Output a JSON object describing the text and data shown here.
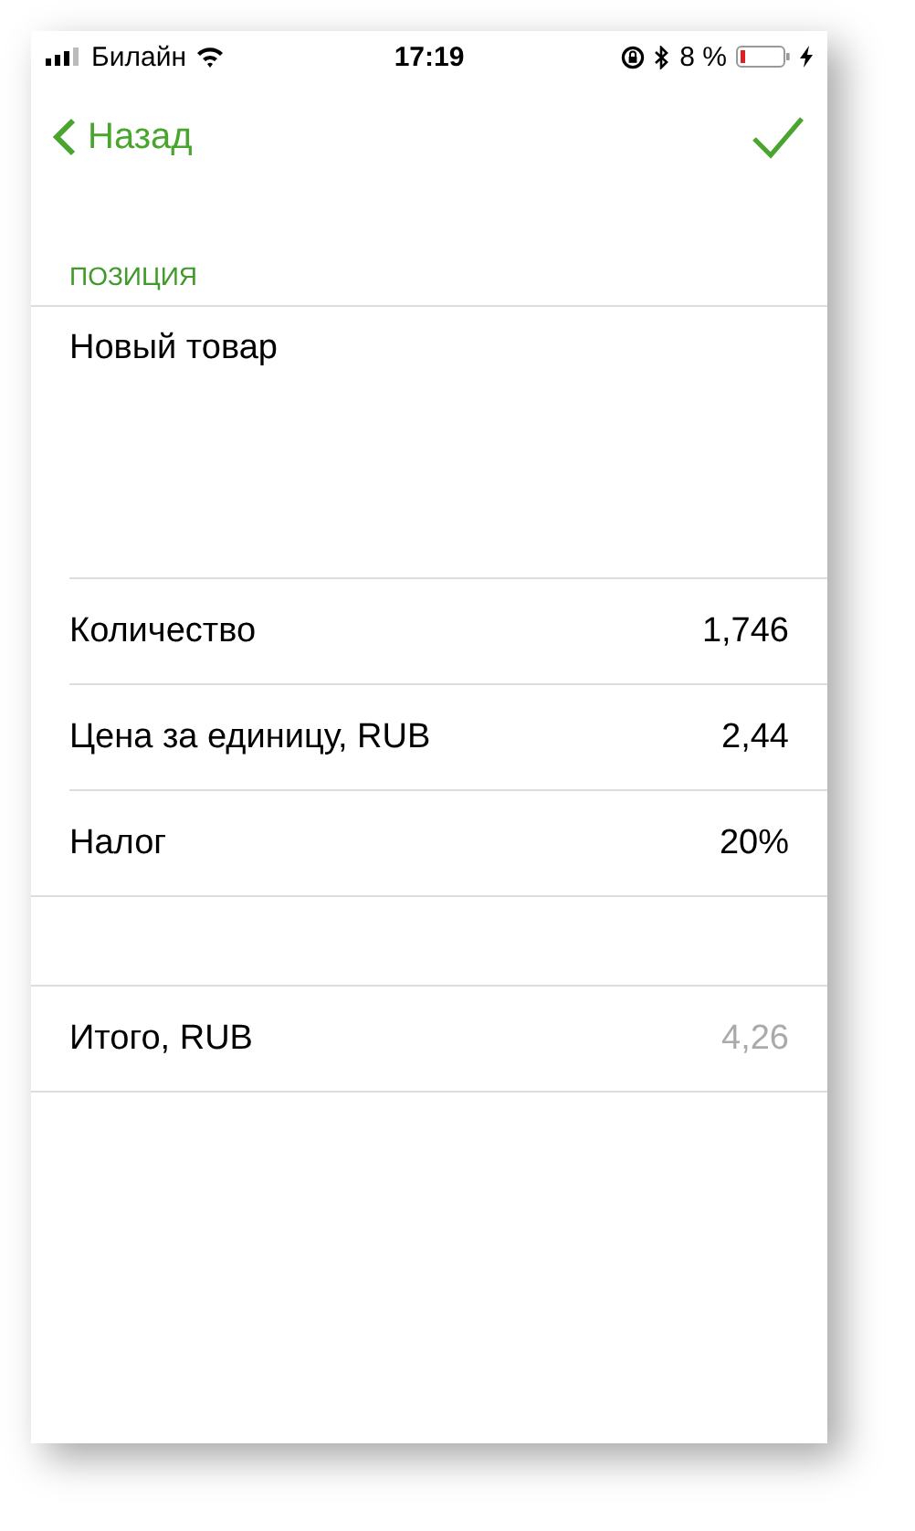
{
  "status_bar": {
    "carrier": "Билайн",
    "time": "17:19",
    "battery": "8 %"
  },
  "nav": {
    "back": "Назад"
  },
  "section": {
    "header": "ПОЗИЦИЯ",
    "name": {
      "value": "Новый товар"
    }
  },
  "rows": [
    {
      "label": "Количество",
      "value": "1,746",
      "disabled": false
    },
    {
      "label": "Цена за единицу, RUB",
      "value": "2,44",
      "disabled": false
    },
    {
      "label": "Налог",
      "value": "20%",
      "disabled": false
    }
  ],
  "total": {
    "label": "Итого, RUB",
    "value": "4,26",
    "disabled": true
  }
}
